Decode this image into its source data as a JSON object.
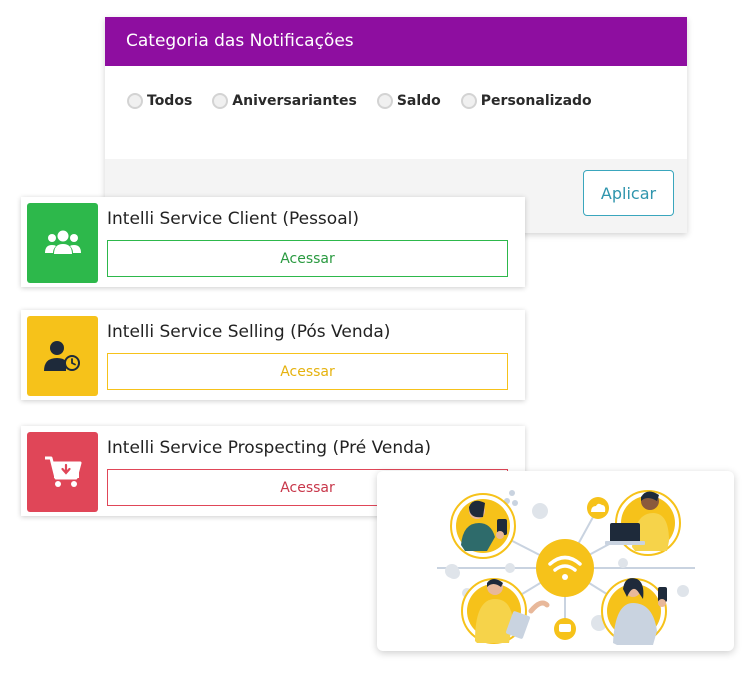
{
  "notifications": {
    "title": "Categoria das Notificações",
    "header_color": "#8e0ea0",
    "options": [
      {
        "label": "Todos",
        "selected": false
      },
      {
        "label": "Aniversariantes",
        "selected": false
      },
      {
        "label": "Saldo",
        "selected": false
      },
      {
        "label": "Personalizado",
        "selected": false
      }
    ],
    "apply_label": "Aplicar"
  },
  "services": [
    {
      "title": "Intelli Service Client (Pessoal)",
      "button": "Acessar",
      "color": "#2db84b",
      "icon": "users-group-icon"
    },
    {
      "title": "Intelli Service Selling (Pós Venda)",
      "button": "Acessar",
      "color": "#f6c21a",
      "icon": "user-clock-icon"
    },
    {
      "title": "Intelli Service Prospecting (Pré Venda)",
      "button": "Acessar",
      "color": "#e04658",
      "icon": "cart-download-icon"
    }
  ],
  "illustration": {
    "icon": "connected-people-wifi-illustration",
    "accent": "#f6c21a"
  }
}
